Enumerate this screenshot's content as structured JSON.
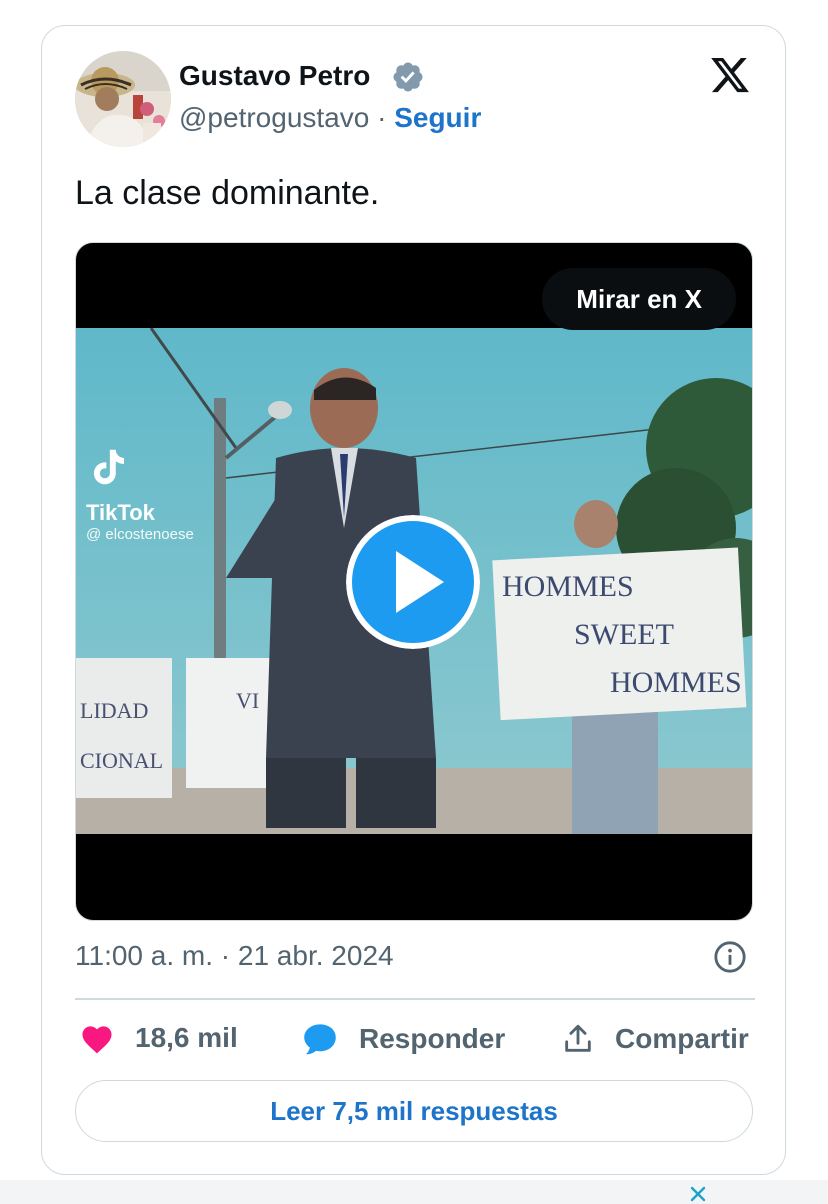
{
  "author": {
    "name": "Gustavo Petro",
    "handle": "@petrogustavo",
    "separator": "·",
    "follow_label": "Seguir"
  },
  "tweet": {
    "text": "La clase dominante."
  },
  "media": {
    "watch_label": "Mirar en X",
    "tiktok_brand": "TikTok",
    "tiktok_user": "@ elcostenoese",
    "sign_text": [
      "HOMMES",
      "SWEET",
      "HOMMES"
    ]
  },
  "meta": {
    "timestamp": "11:00 a. m. · 21 abr. 2024"
  },
  "actions": {
    "likes": "18,6 mil",
    "reply_label": "Responder",
    "share_label": "Compartir"
  },
  "read_replies_label": "Leer 7,5 mil respuestas",
  "colors": {
    "accent": "#1d74c9",
    "like": "#f91880",
    "play": "#1d9bf0",
    "border": "#cfd9de"
  },
  "icons": {
    "verified": "verified-badge-icon",
    "x_logo": "x-logo-icon",
    "play": "play-icon",
    "info": "info-icon",
    "heart": "heart-icon",
    "reply": "reply-bubble-icon",
    "share": "share-upload-icon",
    "close": "close-icon"
  }
}
